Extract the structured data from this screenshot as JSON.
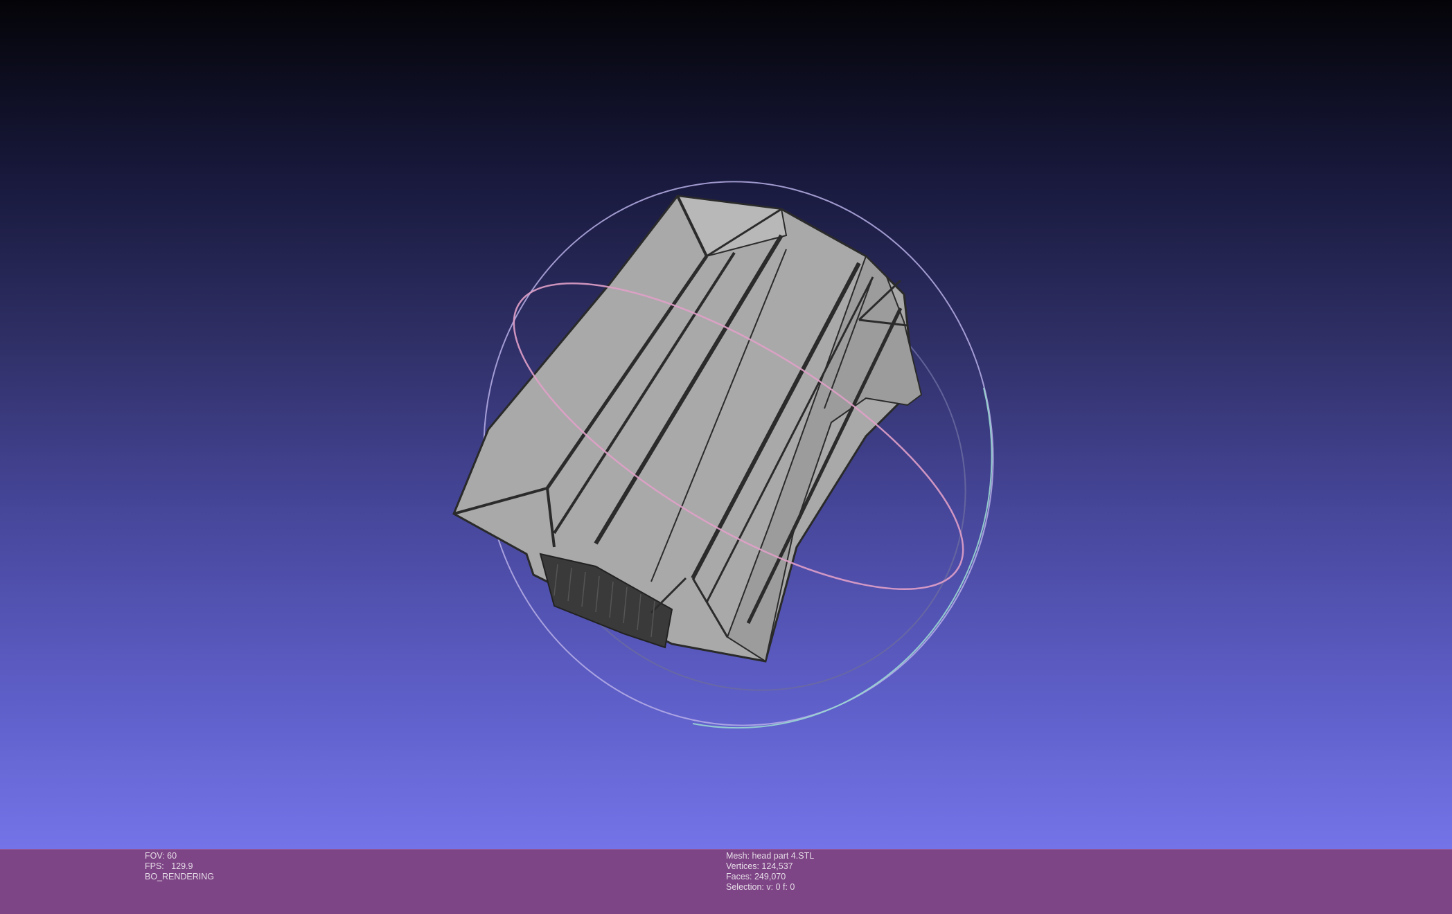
{
  "viewport": {
    "background_top": "#040408",
    "background_bottom": "#7474e8",
    "mesh_color": "#a8a8a8",
    "wire_color": "#2a2a2a",
    "trackball_colors": [
      "#c0b8f0",
      "#e8a8c8",
      "#9ad8d0"
    ]
  },
  "info": {
    "left": {
      "fov": "FOV: 60",
      "fps": "FPS:   129.9",
      "mode": "BO_RENDERING"
    },
    "right": {
      "mesh": "Mesh: head part 4.STL",
      "vertices": "Vertices: 124,537",
      "faces": "Faces: 249,070",
      "selection": "Selection: v: 0 f: 0"
    },
    "bar_color": "#7d4585"
  }
}
